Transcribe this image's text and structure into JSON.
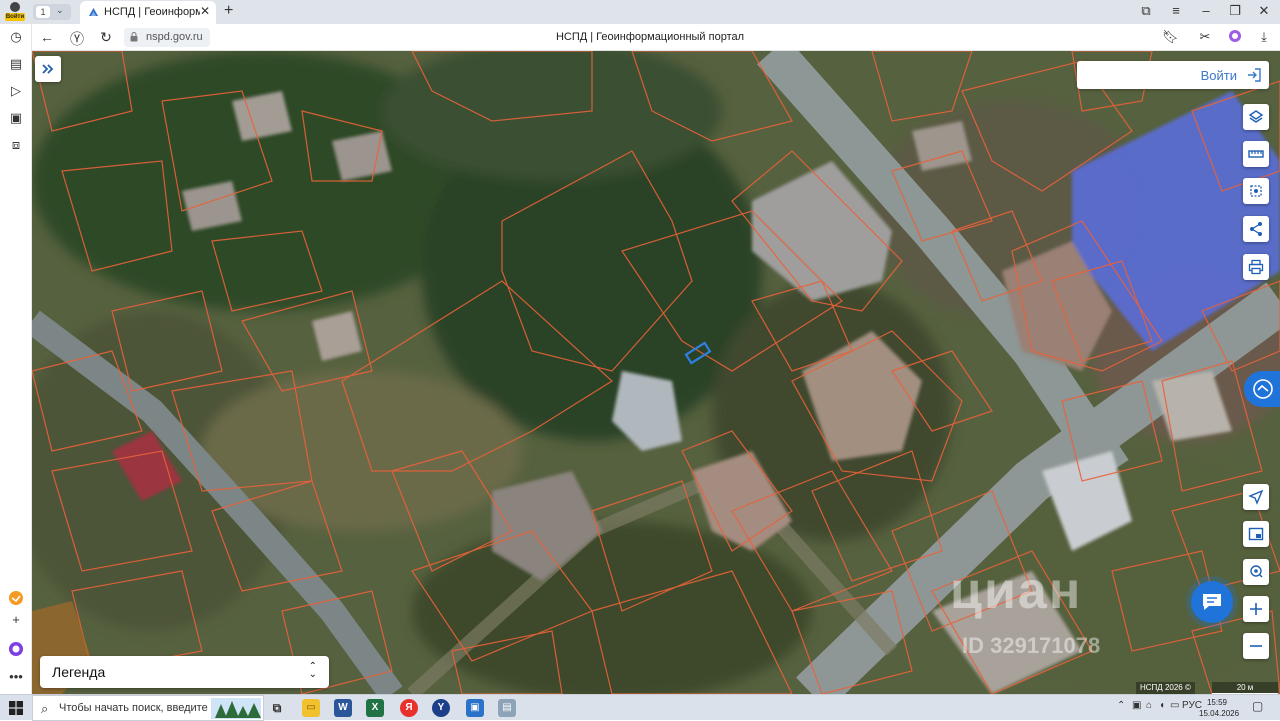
{
  "browser": {
    "profile_badge": "Войти",
    "tab_count": "1",
    "tab_title": "НСПД | Геоинформацио",
    "url": "nspd.gov.ru",
    "page_title": "НСПД | Геоинформационный портал"
  },
  "map": {
    "login_label": "Войти",
    "legend_label": "Легенда",
    "watermark": "циан",
    "watermark_id": "ID 329171078",
    "copyright": "НСПД 2026 ©",
    "scale": "20 м",
    "controls": [
      "layers-icon",
      "ruler-icon",
      "select-area-icon",
      "share-icon",
      "print-icon",
      "locate-icon",
      "minimap-icon",
      "geo-search-icon",
      "zoom-in-icon",
      "zoom-out-icon"
    ]
  },
  "taskbar": {
    "search_text": "Чтобы начать поиск, введите",
    "language": "РУС",
    "time": "15:59",
    "date": "15.04.2026"
  },
  "colors": {
    "parcel_outline": "#e8623a",
    "selected_parcel": "#2f7fe0",
    "accent": "#1f73d9",
    "building_highlight": "#5a6fe0"
  }
}
